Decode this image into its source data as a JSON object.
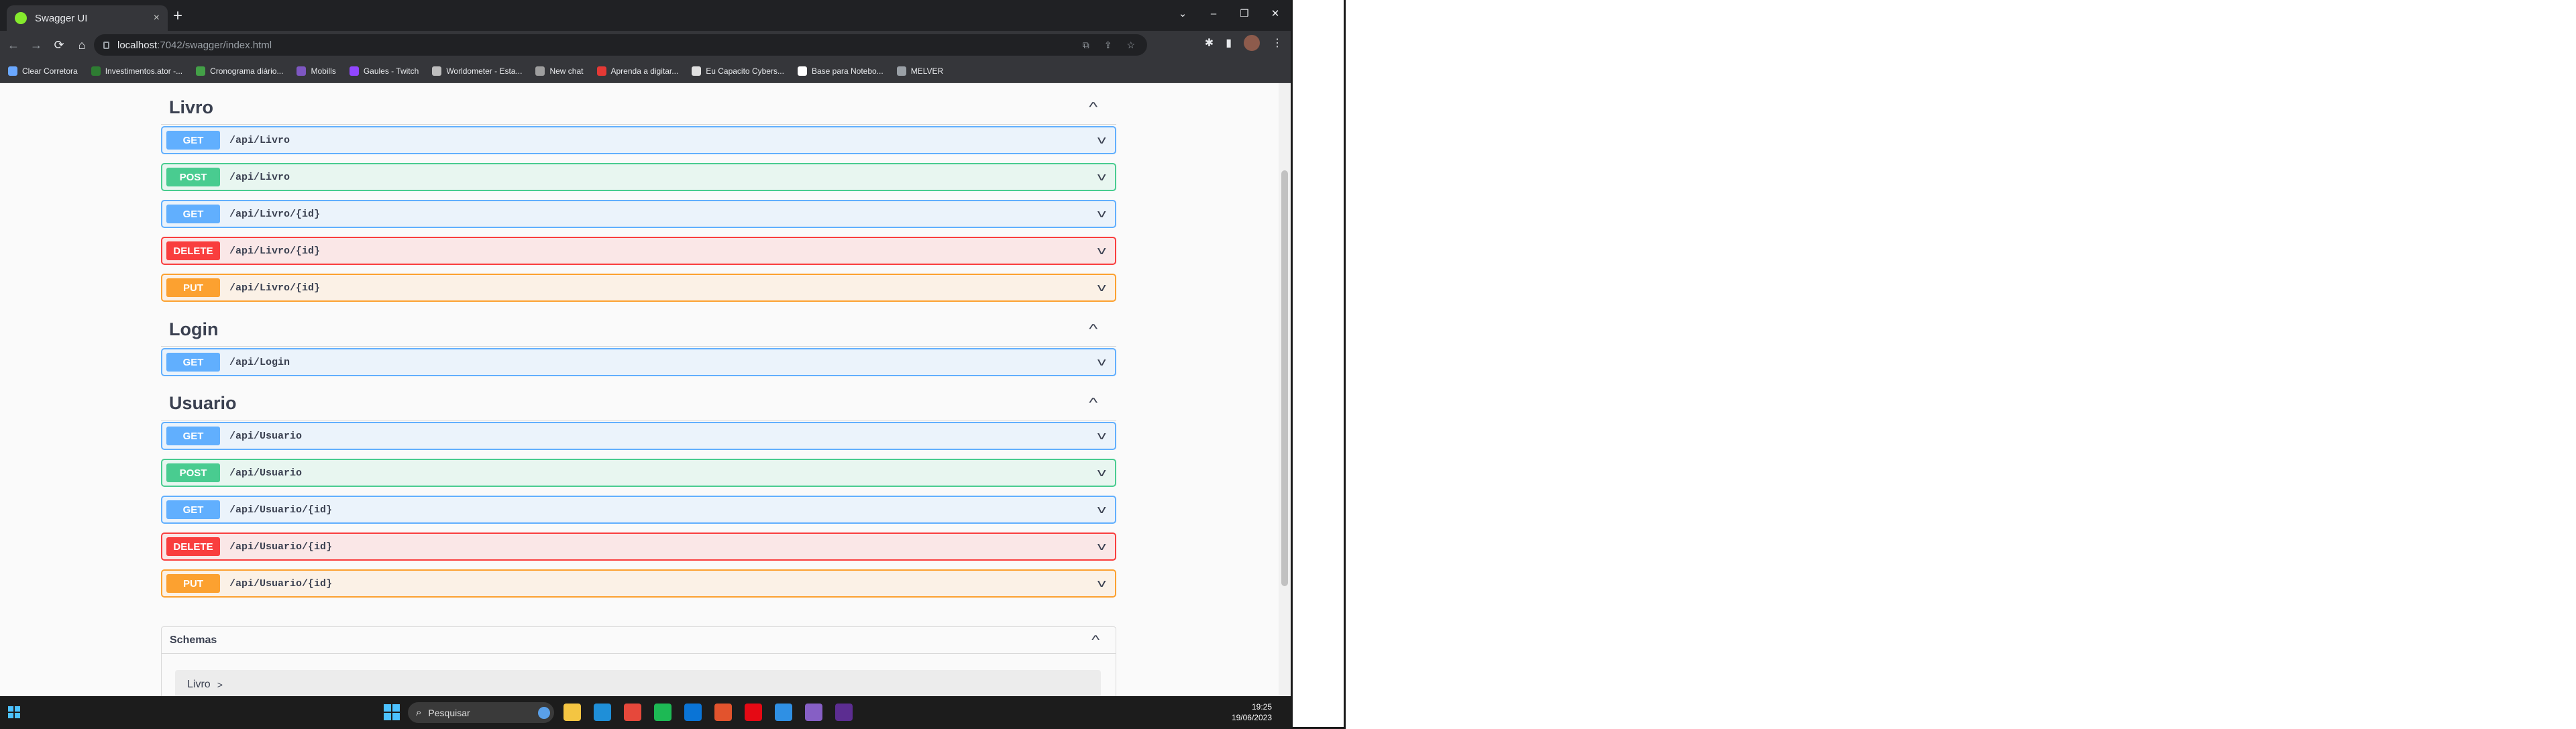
{
  "browser": {
    "tab_title": "Swagger UI",
    "tab_close": "×",
    "new_tab": "+",
    "window_controls": [
      "⌄",
      "–",
      "❐",
      "✕"
    ],
    "nav": {
      "back": "←",
      "forward": "→",
      "reload": "⟳",
      "home": "⌂"
    },
    "url_host": "localhost",
    "url_rest": ":7042/swagger/index.html",
    "omnibox_icons": [
      "⧉",
      "⇪",
      "☆"
    ],
    "extension_icons": [
      "✱",
      "▮",
      "⋮"
    ]
  },
  "bookmarks": [
    {
      "label": "Clear Corretora",
      "color": "#6aa8ff"
    },
    {
      "label": "Investimentos.ator -...",
      "color": "#2e7d32"
    },
    {
      "label": "Cronograma diário...",
      "color": "#43a047"
    },
    {
      "label": "Mobills",
      "color": "#7e57c2"
    },
    {
      "label": "Gaules - Twitch",
      "color": "#9146ff"
    },
    {
      "label": "Worldometer - Esta...",
      "color": "#bdbdbd"
    },
    {
      "label": "New chat",
      "color": "#9e9e9e"
    },
    {
      "label": "Aprenda a digitar...",
      "color": "#e53935"
    },
    {
      "label": "Eu Capacito Cybers...",
      "color": "#e0e0e0"
    },
    {
      "label": "Base para Notebo...",
      "color": "#ffffff"
    },
    {
      "label": "MELVER",
      "color": "#9aa0a6"
    }
  ],
  "swagger": {
    "tags": [
      {
        "name": "Livro",
        "chevron": "^",
        "operations": [
          {
            "method": "GET",
            "path": "/api/Livro"
          },
          {
            "method": "POST",
            "path": "/api/Livro"
          },
          {
            "method": "GET",
            "path": "/api/Livro/{id}"
          },
          {
            "method": "DELETE",
            "path": "/api/Livro/{id}"
          },
          {
            "method": "PUT",
            "path": "/api/Livro/{id}"
          }
        ]
      },
      {
        "name": "Login",
        "chevron": "^",
        "operations": [
          {
            "method": "GET",
            "path": "/api/Login"
          }
        ]
      },
      {
        "name": "Usuario",
        "chevron": "^",
        "operations": [
          {
            "method": "GET",
            "path": "/api/Usuario"
          },
          {
            "method": "POST",
            "path": "/api/Usuario"
          },
          {
            "method": "GET",
            "path": "/api/Usuario/{id}"
          },
          {
            "method": "DELETE",
            "path": "/api/Usuario/{id}"
          },
          {
            "method": "PUT",
            "path": "/api/Usuario/{id}"
          }
        ]
      }
    ],
    "op_chevron": "v",
    "schemas": {
      "title": "Schemas",
      "chevron": "^",
      "models": [
        {
          "name": "Livro",
          "arrow": ">"
        }
      ]
    },
    "method_colors": {
      "GET": "#61affe",
      "POST": "#49cc90",
      "DELETE": "#f93e3e",
      "PUT": "#fca130"
    }
  },
  "taskbar": {
    "search_icon": "⌕",
    "search_placeholder": "Pesquisar",
    "apps": [
      {
        "name": "file-explorer",
        "color": "#f4c542"
      },
      {
        "name": "edge",
        "color": "#1f8fd8"
      },
      {
        "name": "chrome",
        "color": "#e6483b"
      },
      {
        "name": "spotify",
        "color": "#1db954"
      },
      {
        "name": "outlook",
        "color": "#0a74d6"
      },
      {
        "name": "office",
        "color": "#e2532d"
      },
      {
        "name": "netflix",
        "color": "#e50914"
      },
      {
        "name": "vscode",
        "color": "#2f90e4"
      },
      {
        "name": "visual-studio",
        "color": "#865fc5"
      },
      {
        "name": "other-app",
        "color": "#5c2d91"
      }
    ],
    "time": "19:25",
    "date": "19/06/2023"
  }
}
